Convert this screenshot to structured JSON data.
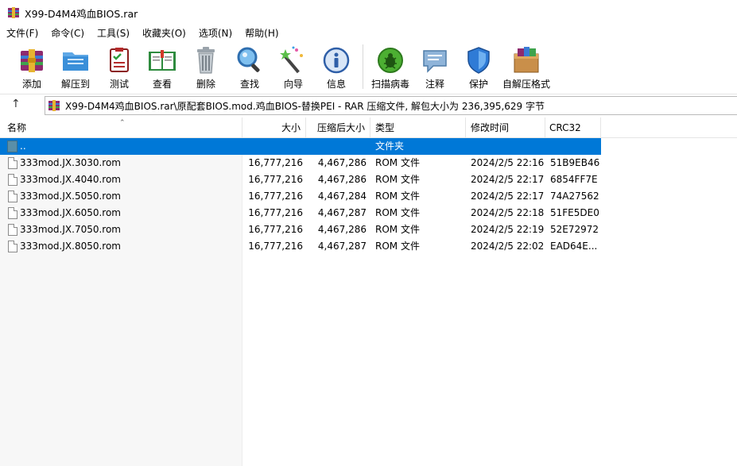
{
  "window": {
    "title": "X99-D4M4鸡血BIOS.rar"
  },
  "menu": [
    "文件(F)",
    "命令(C)",
    "工具(S)",
    "收藏夹(O)",
    "选项(N)",
    "帮助(H)"
  ],
  "toolbar": [
    {
      "label": "添加",
      "icon": "add-archive-icon"
    },
    {
      "label": "解压到",
      "icon": "extract-to-icon"
    },
    {
      "label": "测试",
      "icon": "test-icon"
    },
    {
      "label": "查看",
      "icon": "view-book-icon"
    },
    {
      "label": "删除",
      "icon": "trash-icon"
    },
    {
      "label": "查找",
      "icon": "find-magnifier-icon"
    },
    {
      "label": "向导",
      "icon": "wizard-wand-icon"
    },
    {
      "label": "信息",
      "icon": "info-icon"
    },
    {
      "label": "扫描病毒",
      "icon": "virus-scan-icon"
    },
    {
      "label": "注释",
      "icon": "comment-icon"
    },
    {
      "label": "保护",
      "icon": "shield-icon"
    },
    {
      "label": "自解压格式",
      "icon": "sfx-box-icon"
    }
  ],
  "address": {
    "text": "X99-D4M4鸡血BIOS.rar\\原配套BIOS.mod.鸡血BIOS-替换PEI - RAR 压缩文件, 解包大小为 236,395,629 字节"
  },
  "columns": {
    "name": "名称",
    "size": "大小",
    "packed": "压缩后大小",
    "type": "类型",
    "modified": "修改时间",
    "crc": "CRC32"
  },
  "parent_row": {
    "name": "..",
    "type": "文件夹"
  },
  "files": [
    {
      "name": "333mod.JX.3030.rom",
      "size": "16,777,216",
      "packed": "4,467,286",
      "type": "ROM 文件",
      "modified": "2024/2/5 22:16",
      "crc": "51B9EB46"
    },
    {
      "name": "333mod.JX.4040.rom",
      "size": "16,777,216",
      "packed": "4,467,286",
      "type": "ROM 文件",
      "modified": "2024/2/5 22:17",
      "crc": "6854FF7E"
    },
    {
      "name": "333mod.JX.5050.rom",
      "size": "16,777,216",
      "packed": "4,467,284",
      "type": "ROM 文件",
      "modified": "2024/2/5 22:17",
      "crc": "74A27562"
    },
    {
      "name": "333mod.JX.6050.rom",
      "size": "16,777,216",
      "packed": "4,467,287",
      "type": "ROM 文件",
      "modified": "2024/2/5 22:18",
      "crc": "51FE5DE0"
    },
    {
      "name": "333mod.JX.7050.rom",
      "size": "16,777,216",
      "packed": "4,467,286",
      "type": "ROM 文件",
      "modified": "2024/2/5 22:19",
      "crc": "52E72972"
    },
    {
      "name": "333mod.JX.8050.rom",
      "size": "16,777,216",
      "packed": "4,467,287",
      "type": "ROM 文件",
      "modified": "2024/2/5 22:02",
      "crc": "EAD64E..."
    }
  ]
}
